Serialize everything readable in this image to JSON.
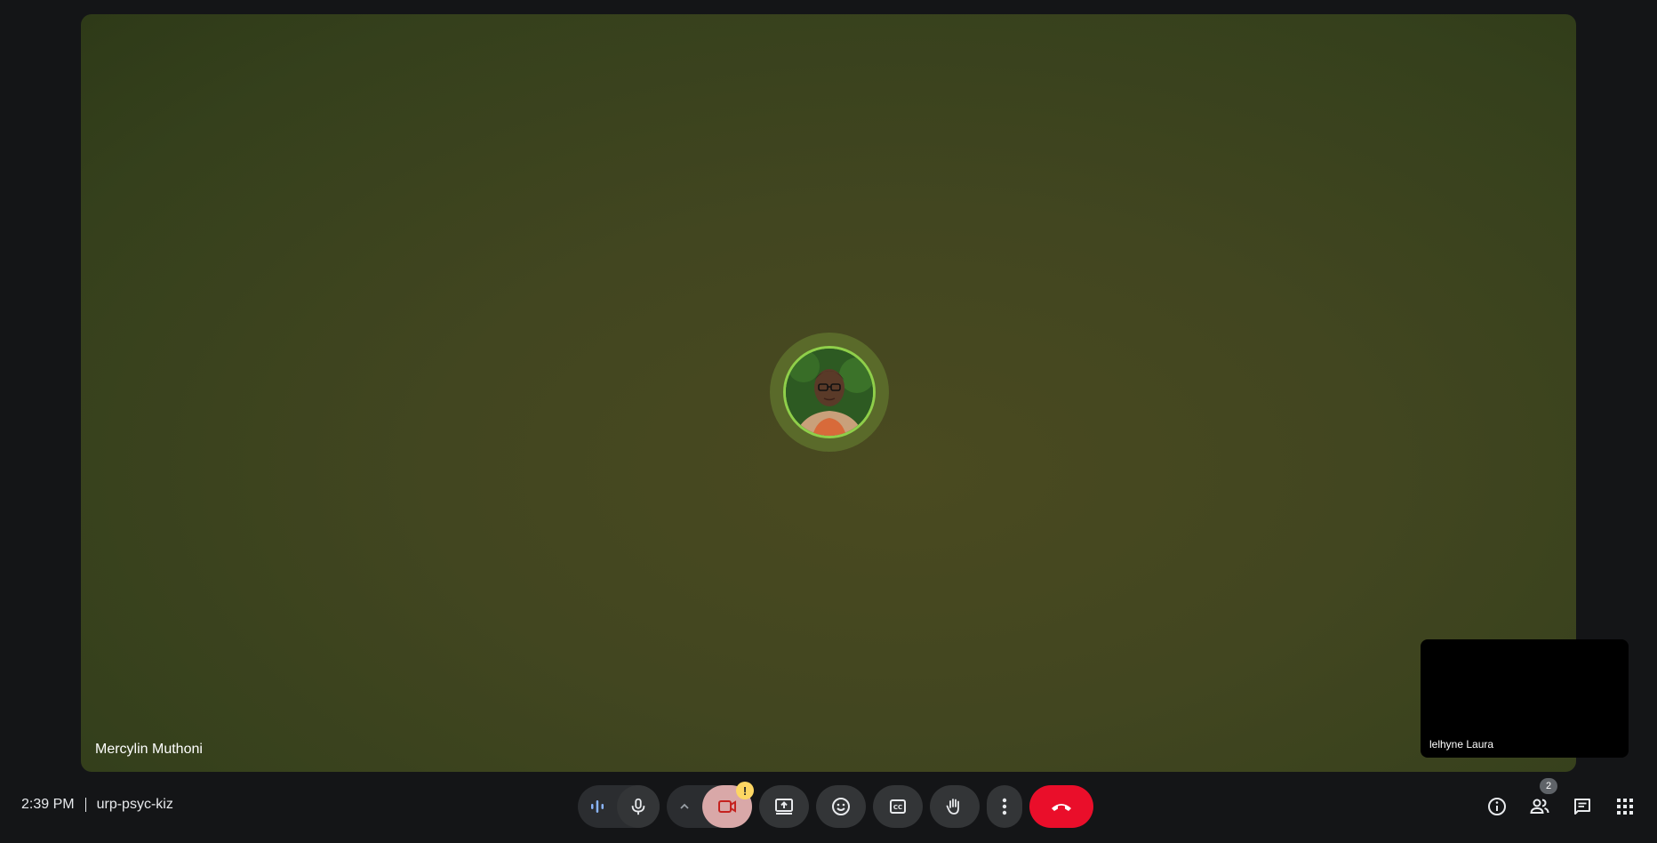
{
  "stage": {
    "speaker_name": "Mercylin Muthoni",
    "self_name": "lelhyne Laura"
  },
  "footer": {
    "time": "2:39 PM",
    "meeting_code": "urp-psyc-kiz"
  },
  "controls": {
    "camera_warning": "!",
    "end_call_color": "#ea0e2a",
    "camera_off_color": "#d9a8a8"
  },
  "right": {
    "people_count": "2"
  },
  "icons": [
    "audio-level-icon",
    "mic-icon",
    "chevron-up-icon",
    "camera-off-icon",
    "present-icon",
    "emoji-icon",
    "captions-icon",
    "raise-hand-icon",
    "more-vert-icon",
    "end-call-icon",
    "info-icon",
    "people-icon",
    "chat-icon",
    "apps-icon"
  ]
}
